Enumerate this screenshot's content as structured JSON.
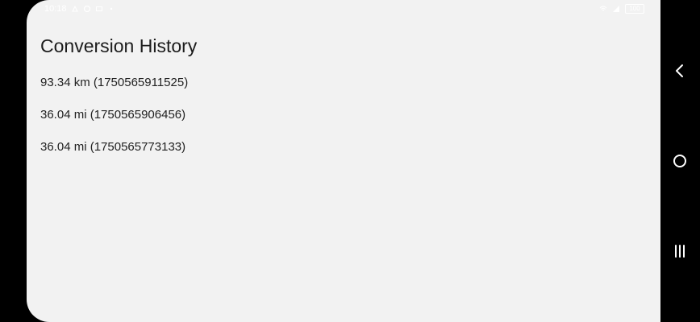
{
  "status_bar": {
    "time": "10:18",
    "battery": "100"
  },
  "screen": {
    "title": "Conversion History",
    "history": [
      {
        "text": "93.34 km (1750565911525)"
      },
      {
        "text": "36.04 mi (1750565906456)"
      },
      {
        "text": "36.04 mi (1750565773133)"
      }
    ]
  },
  "nav": {
    "icons": [
      "back-icon",
      "home-icon",
      "recents-icon"
    ]
  },
  "colors": {
    "screen_bg": "#f2f2f2",
    "frame_bg": "#000000",
    "text": "#222222"
  }
}
